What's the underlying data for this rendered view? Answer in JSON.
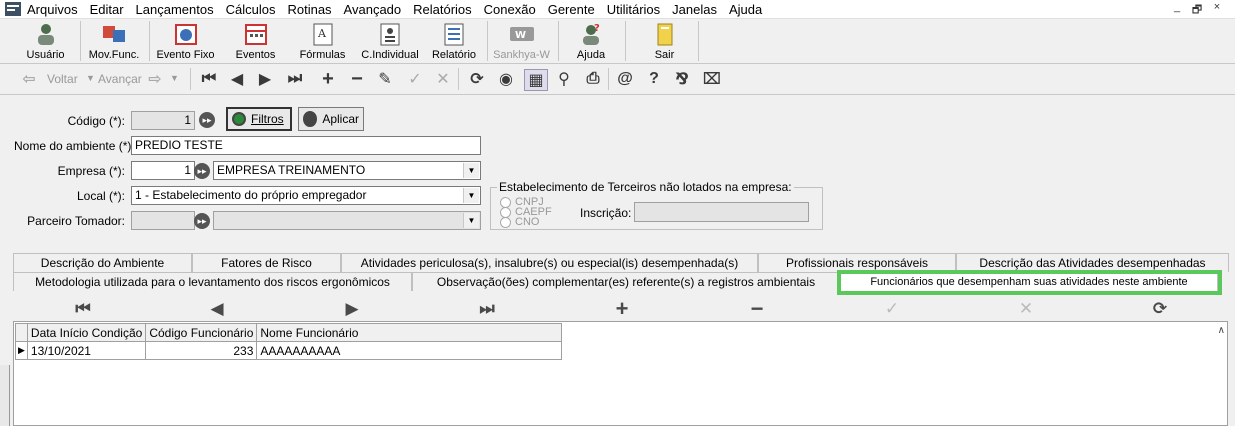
{
  "menu": {
    "items": [
      "Arquivos",
      "Editar",
      "Lançamentos",
      "Cálculos",
      "Rotinas",
      "Avançado",
      "Relatórios",
      "Conexão",
      "Gerente",
      "Utilitários",
      "Janelas",
      "Ajuda"
    ],
    "window_controls": [
      "_",
      "🗗",
      "×"
    ]
  },
  "main_toolbar": {
    "buttons": [
      {
        "label": "Usuário",
        "icon": "user-icon"
      },
      {
        "label": "Mov.Func.",
        "icon": "transfer-icon"
      },
      {
        "label": "Evento Fixo",
        "icon": "globe-calendar-icon"
      },
      {
        "label": "Eventos",
        "icon": "calendar-icon"
      },
      {
        "label": "Fórmulas",
        "icon": "formula-icon"
      },
      {
        "label": "C.Individual",
        "icon": "id-card-icon"
      },
      {
        "label": "Relatório",
        "icon": "report-icon"
      },
      {
        "label": "Sankhya-W",
        "icon": "sankhya-logo-icon"
      },
      {
        "label": "Ajuda",
        "icon": "help-user-icon"
      },
      {
        "label": "Sair",
        "icon": "exit-icon"
      }
    ]
  },
  "nav_toolbar": {
    "back_label": "Voltar",
    "forward_label": "Avançar"
  },
  "form": {
    "codigo_label": "Código (*):",
    "codigo_value": "1",
    "filtros_label": "Filtros",
    "aplicar_label": "Aplicar",
    "nome_label": "Nome do ambiente (*):",
    "nome_value": "PREDIO TESTE",
    "empresa_label": "Empresa (*):",
    "empresa_code": "1",
    "empresa_name": "EMPRESA TREINAMENTO",
    "local_label": "Local (*):",
    "local_value": "1 - Estabelecimento do próprio empregador",
    "parceiro_label": "Parceiro Tomador:",
    "parceiro_value": "",
    "terceiros_group_label": "Estabelecimento de Terceiros não lotados na empresa:",
    "radio_options": [
      "CNPJ",
      "CAEPF",
      "CNO"
    ],
    "inscricao_label": "Inscrição:",
    "inscricao_value": ""
  },
  "tabs": {
    "row1": [
      "Descrição do Ambiente",
      "Fatores de Risco",
      "Atividades periculosa(s), insalubre(s) ou especial(is) desempenhada(s)",
      "Profissionais responsáveis",
      "Descrição das Atividades desempenhadas"
    ],
    "row2": [
      "Metodologia utilizada para o levantamento dos riscos ergonômicos",
      "Observação(ões) complementar(es) referente(s) a registros ambientais",
      "Funcionários que desempenham suas atividades neste ambiente"
    ]
  },
  "grid": {
    "columns": [
      "Data Início Condição",
      "Código Funcionário",
      "Nome Funcionário"
    ],
    "rows": [
      {
        "data": "13/10/2021",
        "codigo": "233",
        "nome": "AAAAAAAAAA"
      }
    ]
  },
  "colors": {
    "highlight": "#5ac85a"
  }
}
